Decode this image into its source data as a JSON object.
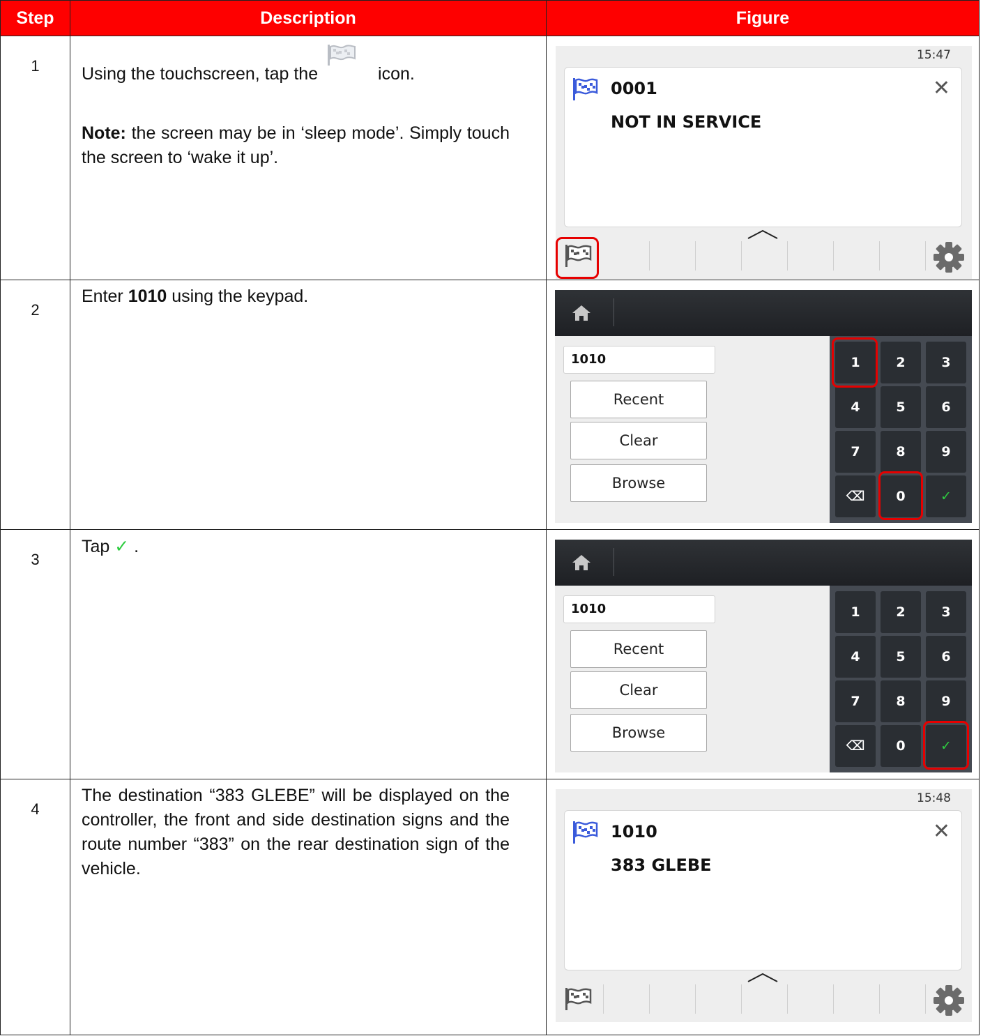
{
  "header": {
    "step": "Step",
    "description": "Description",
    "figure": "Figure"
  },
  "rows": [
    {
      "num": "1",
      "text_before_icon": "Using the touchscreen, tap the",
      "text_after_icon": "icon.",
      "note_label": "Note:",
      "note_text": " the screen may be in ‘sleep mode’. Simply touch the screen to ‘wake it up’.",
      "screen": {
        "time": "15:47",
        "route_code": "0001",
        "destination": "NOT IN SERVICE"
      }
    },
    {
      "num": "2",
      "text_before": "Enter ",
      "text_bold": "1010",
      "text_after": " using the keypad."
    },
    {
      "num": "3",
      "text_before": "Tap ",
      "tick": "✓",
      "text_after": " ."
    },
    {
      "num": "4",
      "text": "The destination “383 GLEBE” will be displayed on the controller, the front and side destination signs and the route number “383” on the rear destination sign of the vehicle.",
      "screen": {
        "time": "15:48",
        "route_code": "1010",
        "destination": "383 GLEBE"
      }
    }
  ],
  "keypad_screen": {
    "entry_value": "1010",
    "buttons": [
      "Recent",
      "Clear",
      "Browse"
    ],
    "keys": [
      "1",
      "2",
      "3",
      "4",
      "5",
      "6",
      "7",
      "8",
      "9",
      "⌫",
      "0",
      "✓"
    ]
  },
  "icons": {
    "flag": "flag-icon",
    "close": "close-icon",
    "gear": "gear-icon",
    "home": "home-icon",
    "backspace": "backspace-icon",
    "check": "check-icon",
    "chevron": "chevron-up-icon"
  },
  "colors": {
    "header_red": "#fe0000",
    "highlight_red": "#e60000",
    "check_green": "#2ecc40",
    "flag_blue": "#3b5bdb"
  }
}
